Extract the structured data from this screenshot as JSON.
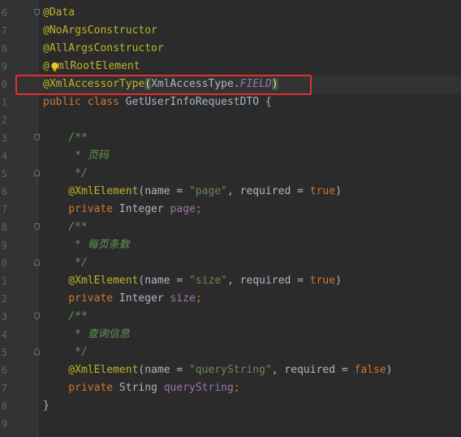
{
  "editor": {
    "lines": [
      {
        "num": "6",
        "tokens": [
          {
            "c": "ann",
            "t": "@Data"
          }
        ]
      },
      {
        "num": "7",
        "tokens": [
          {
            "c": "ann",
            "t": "@NoArgsConstructor"
          }
        ]
      },
      {
        "num": "8",
        "tokens": [
          {
            "c": "ann",
            "t": "@AllArgsConstructor"
          }
        ]
      },
      {
        "num": "9",
        "tokens": [
          {
            "c": "ann",
            "t": "@"
          },
          {
            "c": "ann",
            "t": "mlRootElement"
          }
        ]
      },
      {
        "num": "0",
        "tokens": [
          {
            "c": "ann",
            "t": "@XmlAccessorType"
          },
          {
            "c": "paren-hl",
            "t": "("
          },
          {
            "c": "plain",
            "t": "XmlAccessType."
          },
          {
            "c": "static-field",
            "t": "FIELD"
          },
          {
            "c": "paren-hl",
            "t": ")"
          }
        ]
      },
      {
        "num": "1",
        "tokens": [
          {
            "c": "kw",
            "t": "public class "
          },
          {
            "c": "plain",
            "t": "GetUserInfoRequestDTO {"
          }
        ]
      },
      {
        "num": "2",
        "tokens": []
      },
      {
        "num": "3",
        "tokens": [
          {
            "c": "doc",
            "t": "    /**"
          }
        ]
      },
      {
        "num": "4",
        "tokens": [
          {
            "c": "doc",
            "t": "     * 页码"
          }
        ]
      },
      {
        "num": "5",
        "tokens": [
          {
            "c": "doc",
            "t": "     */"
          }
        ]
      },
      {
        "num": "6",
        "tokens": [
          {
            "c": "ann",
            "t": "    @XmlElement"
          },
          {
            "c": "plain",
            "t": "(name = "
          },
          {
            "c": "str",
            "t": "\"page\""
          },
          {
            "c": "plain",
            "t": ", required = "
          },
          {
            "c": "kw",
            "t": "true"
          },
          {
            "c": "plain",
            "t": ")"
          }
        ]
      },
      {
        "num": "7",
        "tokens": [
          {
            "c": "kw",
            "t": "    private "
          },
          {
            "c": "plain",
            "t": "Integer "
          },
          {
            "c": "field",
            "t": "page"
          },
          {
            "c": "kw",
            "t": ";"
          }
        ]
      },
      {
        "num": "8",
        "tokens": [
          {
            "c": "doc",
            "t": "    /**"
          }
        ]
      },
      {
        "num": "9",
        "tokens": [
          {
            "c": "doc",
            "t": "     * 每页条数"
          }
        ]
      },
      {
        "num": "0",
        "tokens": [
          {
            "c": "doc",
            "t": "     */"
          }
        ]
      },
      {
        "num": "1",
        "tokens": [
          {
            "c": "ann",
            "t": "    @XmlElement"
          },
          {
            "c": "plain",
            "t": "(name = "
          },
          {
            "c": "str",
            "t": "\"size\""
          },
          {
            "c": "plain",
            "t": ", required = "
          },
          {
            "c": "kw",
            "t": "true"
          },
          {
            "c": "plain",
            "t": ")"
          }
        ]
      },
      {
        "num": "2",
        "tokens": [
          {
            "c": "kw",
            "t": "    private "
          },
          {
            "c": "plain",
            "t": "Integer "
          },
          {
            "c": "field",
            "t": "size"
          },
          {
            "c": "kw",
            "t": ";"
          }
        ]
      },
      {
        "num": "3",
        "tokens": [
          {
            "c": "doc",
            "t": "    /**"
          }
        ]
      },
      {
        "num": "4",
        "tokens": [
          {
            "c": "doc",
            "t": "     * 查询信息"
          }
        ]
      },
      {
        "num": "5",
        "tokens": [
          {
            "c": "doc",
            "t": "     */"
          }
        ]
      },
      {
        "num": "6",
        "tokens": [
          {
            "c": "ann",
            "t": "    @XmlElement"
          },
          {
            "c": "plain",
            "t": "(name = "
          },
          {
            "c": "str",
            "t": "\"queryString\""
          },
          {
            "c": "plain",
            "t": ", required = "
          },
          {
            "c": "kw",
            "t": "false"
          },
          {
            "c": "plain",
            "t": ")"
          }
        ]
      },
      {
        "num": "7",
        "tokens": [
          {
            "c": "kw",
            "t": "    private "
          },
          {
            "c": "plain",
            "t": "String "
          },
          {
            "c": "field",
            "t": "queryString"
          },
          {
            "c": "kw",
            "t": ";"
          }
        ]
      },
      {
        "num": "8",
        "tokens": [
          {
            "c": "plain",
            "t": "}"
          }
        ]
      },
      {
        "num": "9",
        "tokens": []
      }
    ],
    "current_line_index": 4,
    "highlighted_line_index": 4,
    "fold_markers": [
      {
        "line": 0,
        "kind": "top"
      },
      {
        "line": 7,
        "kind": "top"
      },
      {
        "line": 9,
        "kind": "bottom"
      },
      {
        "line": 12,
        "kind": "top"
      },
      {
        "line": 14,
        "kind": "bottom"
      },
      {
        "line": 17,
        "kind": "top"
      },
      {
        "line": 19,
        "kind": "bottom"
      }
    ],
    "intention_icon": "lightbulb-icon",
    "colors": {
      "background": "#2b2b2b",
      "annotation": "#bbb529",
      "keyword": "#cc7832",
      "string": "#6a8759",
      "field": "#9876aa",
      "doc_comment": "#629755",
      "highlight_box": "#e03030"
    }
  }
}
